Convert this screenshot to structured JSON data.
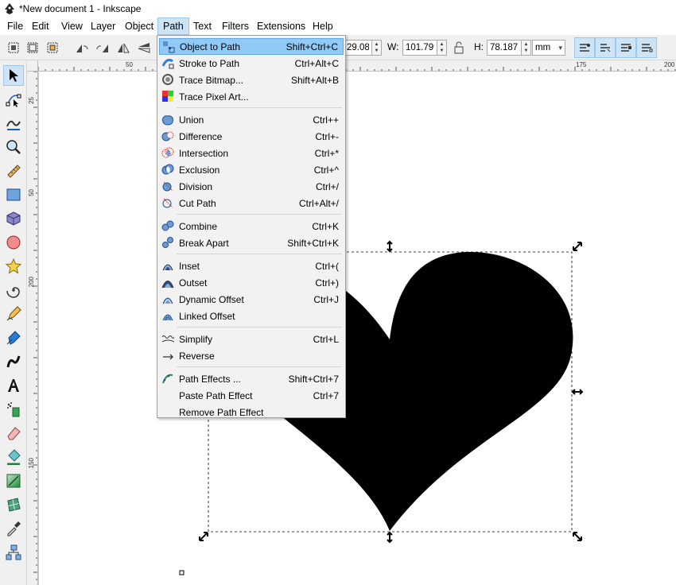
{
  "window": {
    "title": "*New document 1 - Inkscape"
  },
  "menubar": {
    "items": [
      "File",
      "Edit",
      "View",
      "Layer",
      "Object",
      "Path",
      "Text",
      "Filters",
      "Extensions",
      "Help"
    ],
    "active": "Path"
  },
  "toolbar": {
    "x_value": "29.085",
    "w_label": "W:",
    "w_value": "101.799",
    "h_label": "H:",
    "h_value": "78.187",
    "unit": "mm"
  },
  "ruler": {
    "top_labels": [
      "50",
      "175",
      "200"
    ],
    "left_labels": [
      "25",
      "50",
      "200",
      "150"
    ]
  },
  "path_menu": {
    "groups": [
      [
        {
          "label": "Object to Path",
          "shortcut": "Shift+Ctrl+C",
          "icon": "object-to-path-icon",
          "highlighted": true
        },
        {
          "label": "Stroke to Path",
          "shortcut": "Ctrl+Alt+C",
          "icon": "stroke-to-path-icon"
        },
        {
          "label": "Trace Bitmap...",
          "shortcut": "Shift+Alt+B",
          "icon": "trace-bitmap-icon"
        },
        {
          "label": "Trace Pixel Art...",
          "shortcut": "",
          "icon": "trace-pixel-art-icon"
        }
      ],
      [
        {
          "label": "Union",
          "shortcut": "Ctrl++",
          "icon": "union-icon"
        },
        {
          "label": "Difference",
          "shortcut": "Ctrl+-",
          "icon": "difference-icon"
        },
        {
          "label": "Intersection",
          "shortcut": "Ctrl+*",
          "icon": "intersection-icon"
        },
        {
          "label": "Exclusion",
          "shortcut": "Ctrl+^",
          "icon": "exclusion-icon"
        },
        {
          "label": "Division",
          "shortcut": "Ctrl+/",
          "icon": "division-icon"
        },
        {
          "label": "Cut Path",
          "shortcut": "Ctrl+Alt+/",
          "icon": "cut-path-icon"
        }
      ],
      [
        {
          "label": "Combine",
          "shortcut": "Ctrl+K",
          "icon": "combine-icon"
        },
        {
          "label": "Break Apart",
          "shortcut": "Shift+Ctrl+K",
          "icon": "break-apart-icon"
        }
      ],
      [
        {
          "label": "Inset",
          "shortcut": "Ctrl+(",
          "icon": "inset-icon"
        },
        {
          "label": "Outset",
          "shortcut": "Ctrl+)",
          "icon": "outset-icon"
        },
        {
          "label": "Dynamic Offset",
          "shortcut": "Ctrl+J",
          "icon": "dynamic-offset-icon"
        },
        {
          "label": "Linked Offset",
          "shortcut": "",
          "icon": "linked-offset-icon"
        }
      ],
      [
        {
          "label": "Simplify",
          "shortcut": "Ctrl+L",
          "icon": "simplify-icon"
        },
        {
          "label": "Reverse",
          "shortcut": "",
          "icon": "reverse-icon"
        }
      ],
      [
        {
          "label": "Path Effects ...",
          "shortcut": "Shift+Ctrl+7",
          "icon": "path-effects-icon"
        },
        {
          "label": "Paste Path Effect",
          "shortcut": "Ctrl+7",
          "icon": ""
        },
        {
          "label": "Remove Path Effect",
          "shortcut": "",
          "icon": ""
        }
      ]
    ]
  },
  "colors": {
    "menu_highlight": "#91c9f7",
    "active_menu": "#cce4f7",
    "heart_fill": "#000000"
  }
}
